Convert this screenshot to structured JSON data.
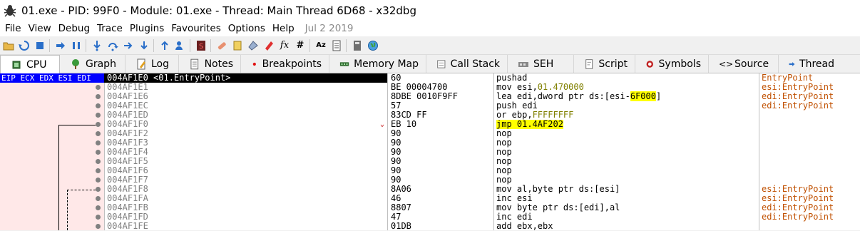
{
  "window": {
    "title": "01.exe - PID: 99F0 - Module: 01.exe - Thread: Main Thread 6D68 - x32dbg",
    "app_icon": "bug-icon"
  },
  "menu": {
    "items": [
      "File",
      "View",
      "Debug",
      "Trace",
      "Plugins",
      "Favourites",
      "Options",
      "Help"
    ],
    "date": "Jul 2 2019"
  },
  "toolbar": {
    "icons": [
      "open-icon",
      "restart-icon",
      "stop-icon",
      "run-icon",
      "pause-icon",
      "step-into-icon",
      "step-over-icon",
      "trace-into-icon",
      "trace-over-icon",
      "execute-till-return-icon",
      "run-to-user-code-icon",
      "scylla-icon",
      "patch-icon",
      "comment-icon",
      "label-icon",
      "bookmark-icon",
      "function-icon",
      "hash-icon",
      "font-icon",
      "script-icon",
      "calculator-icon",
      "globe-icon"
    ]
  },
  "tabs": [
    {
      "label": "CPU",
      "icon": "cpu-icon",
      "active": true
    },
    {
      "label": "Graph",
      "icon": "graph-icon"
    },
    {
      "label": "Log",
      "icon": "log-icon"
    },
    {
      "label": "Notes",
      "icon": "notes-icon"
    },
    {
      "label": "Breakpoints",
      "icon": "breakpoint-icon"
    },
    {
      "label": "Memory Map",
      "icon": "memory-map-icon"
    },
    {
      "label": "Call Stack",
      "icon": "call-stack-icon"
    },
    {
      "label": "SEH",
      "icon": "seh-icon"
    },
    {
      "label": "Script",
      "icon": "script-icon"
    },
    {
      "label": "Symbols",
      "icon": "symbols-icon"
    },
    {
      "label": "Source",
      "icon": "source-icon"
    },
    {
      "label": "Thread",
      "icon": "thread-icon"
    }
  ],
  "cpu": {
    "register_labels": "EIP ECX EDX ESI EDI",
    "rows": [
      {
        "addr": "004AF1E0 <01.EntryPoint>",
        "bytes": "60",
        "dis": "pushad",
        "cmt": "EntryPoint"
      },
      {
        "addr": "004AF1E1",
        "bytes": "BE 00004700",
        "dis": "mov esi,01.470000",
        "cmt": "esi:EntryPoint"
      },
      {
        "addr": "004AF1E6",
        "bytes": "8DBE 0010F9FF",
        "dis": "lea edi,dword ptr ds:[esi-6F000]",
        "cmt": "edi:EntryPoint"
      },
      {
        "addr": "004AF1EC",
        "bytes": "57",
        "dis": "push edi",
        "cmt": "edi:EntryPoint"
      },
      {
        "addr": "004AF1ED",
        "bytes": "83CD FF",
        "dis": "or ebp,FFFFFFFF",
        "cmt": ""
      },
      {
        "addr": "004AF1F0",
        "bytes": "EB 10",
        "dis": "jmp 01.4AF202",
        "cmt": ""
      },
      {
        "addr": "004AF1F2",
        "bytes": "90",
        "dis": "nop",
        "cmt": ""
      },
      {
        "addr": "004AF1F3",
        "bytes": "90",
        "dis": "nop",
        "cmt": ""
      },
      {
        "addr": "004AF1F4",
        "bytes": "90",
        "dis": "nop",
        "cmt": ""
      },
      {
        "addr": "004AF1F5",
        "bytes": "90",
        "dis": "nop",
        "cmt": ""
      },
      {
        "addr": "004AF1F6",
        "bytes": "90",
        "dis": "nop",
        "cmt": ""
      },
      {
        "addr": "004AF1F7",
        "bytes": "90",
        "dis": "nop",
        "cmt": ""
      },
      {
        "addr": "004AF1F8",
        "bytes": "8A06",
        "dis": "mov al,byte ptr ds:[esi]",
        "cmt": "esi:EntryPoint"
      },
      {
        "addr": "004AF1FA",
        "bytes": "46",
        "dis": "inc esi",
        "cmt": "esi:EntryPoint"
      },
      {
        "addr": "004AF1FB",
        "bytes": "8807",
        "dis": "mov byte ptr ds:[edi],al",
        "cmt": "edi:EntryPoint"
      },
      {
        "addr": "004AF1FD",
        "bytes": "47",
        "dis": "inc edi",
        "cmt": "edi:EntryPoint"
      },
      {
        "addr": "004AF1FE",
        "bytes": "01DB",
        "dis": "add ebx,ebx",
        "cmt": ""
      }
    ]
  }
}
